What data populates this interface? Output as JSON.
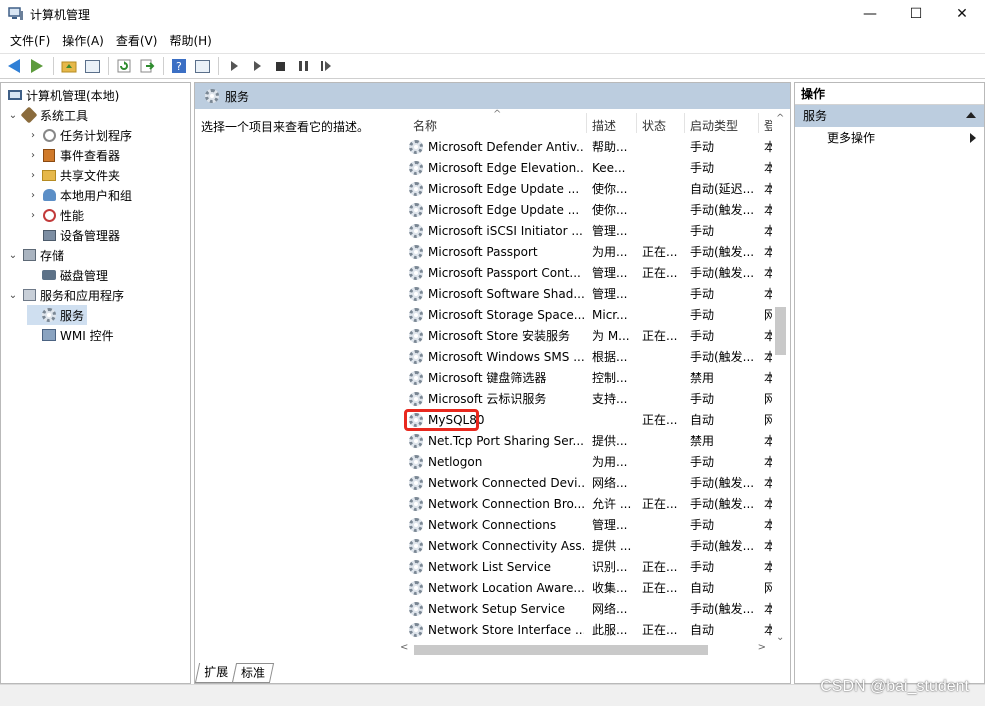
{
  "window": {
    "title": "计算机管理",
    "min": "—",
    "max": "☐",
    "close": "✕"
  },
  "menu": [
    "文件(F)",
    "操作(A)",
    "查看(V)",
    "帮助(H)"
  ],
  "tree": {
    "root": "计算机管理(本地)",
    "items": [
      {
        "label": "系统工具",
        "exp": "⌄"
      },
      {
        "label": "任务计划程序",
        "exp": "›"
      },
      {
        "label": "事件查看器",
        "exp": "›"
      },
      {
        "label": "共享文件夹",
        "exp": "›"
      },
      {
        "label": "本地用户和组",
        "exp": "›"
      },
      {
        "label": "性能",
        "exp": "›"
      },
      {
        "label": "设备管理器",
        "exp": ""
      },
      {
        "label": "存储",
        "exp": "⌄"
      },
      {
        "label": "磁盘管理",
        "exp": ""
      },
      {
        "label": "服务和应用程序",
        "exp": "⌄"
      },
      {
        "label": "服务",
        "exp": ""
      },
      {
        "label": "WMI 控件",
        "exp": ""
      }
    ]
  },
  "middle": {
    "header": "服务",
    "description": "选择一个项目来查看它的描述。",
    "columns": {
      "name": "名称",
      "desc": "描述",
      "status": "状态",
      "startup": "启动类型",
      "logon": "登"
    },
    "sort_indicator": "^",
    "rows": [
      {
        "name": "Microsoft Defender Antiv...",
        "desc": "帮助...",
        "status": "",
        "startup": "手动",
        "logon": "本"
      },
      {
        "name": "Microsoft Edge Elevation...",
        "desc": "Kee...",
        "status": "",
        "startup": "手动",
        "logon": "本"
      },
      {
        "name": "Microsoft Edge Update ...",
        "desc": "使你...",
        "status": "",
        "startup": "自动(延迟...",
        "logon": "本"
      },
      {
        "name": "Microsoft Edge Update ...",
        "desc": "使你...",
        "status": "",
        "startup": "手动(触发...",
        "logon": "本"
      },
      {
        "name": "Microsoft iSCSI Initiator ...",
        "desc": "管理...",
        "status": "",
        "startup": "手动",
        "logon": "本"
      },
      {
        "name": "Microsoft Passport",
        "desc": "为用...",
        "status": "正在...",
        "startup": "手动(触发...",
        "logon": "本"
      },
      {
        "name": "Microsoft Passport Cont...",
        "desc": "管理...",
        "status": "正在...",
        "startup": "手动(触发...",
        "logon": "本"
      },
      {
        "name": "Microsoft Software Shad...",
        "desc": "管理...",
        "status": "",
        "startup": "手动",
        "logon": "本"
      },
      {
        "name": "Microsoft Storage Space...",
        "desc": "Micr...",
        "status": "",
        "startup": "手动",
        "logon": "网"
      },
      {
        "name": "Microsoft Store 安装服务",
        "desc": "为 M...",
        "status": "正在...",
        "startup": "手动",
        "logon": "本"
      },
      {
        "name": "Microsoft Windows SMS ...",
        "desc": "根据...",
        "status": "",
        "startup": "手动(触发...",
        "logon": "本"
      },
      {
        "name": "Microsoft 键盘筛选器",
        "desc": "控制...",
        "status": "",
        "startup": "禁用",
        "logon": "本"
      },
      {
        "name": "Microsoft 云标识服务",
        "desc": "支持...",
        "status": "",
        "startup": "手动",
        "logon": "网"
      },
      {
        "name": "MySQL80",
        "desc": "",
        "status": "正在...",
        "startup": "自动",
        "logon": "网"
      },
      {
        "name": "Net.Tcp Port Sharing Ser...",
        "desc": "提供...",
        "status": "",
        "startup": "禁用",
        "logon": "本"
      },
      {
        "name": "Netlogon",
        "desc": "为用...",
        "status": "",
        "startup": "手动",
        "logon": "本"
      },
      {
        "name": "Network Connected Devi...",
        "desc": "网络...",
        "status": "",
        "startup": "手动(触发...",
        "logon": "本"
      },
      {
        "name": "Network Connection Bro...",
        "desc": "允许 ...",
        "status": "正在...",
        "startup": "手动(触发...",
        "logon": "本"
      },
      {
        "name": "Network Connections",
        "desc": "管理...",
        "status": "",
        "startup": "手动",
        "logon": "本"
      },
      {
        "name": "Network Connectivity Ass...",
        "desc": "提供 ...",
        "status": "",
        "startup": "手动(触发...",
        "logon": "本"
      },
      {
        "name": "Network List Service",
        "desc": "识别...",
        "status": "正在...",
        "startup": "手动",
        "logon": "本"
      },
      {
        "name": "Network Location Aware...",
        "desc": "收集...",
        "status": "正在...",
        "startup": "自动",
        "logon": "网"
      },
      {
        "name": "Network Setup Service",
        "desc": "网络...",
        "status": "",
        "startup": "手动(触发...",
        "logon": "本"
      },
      {
        "name": "Network Store Interface ...",
        "desc": "此服...",
        "status": "正在...",
        "startup": "自动",
        "logon": "本"
      }
    ],
    "tabs": [
      "扩展",
      "标准"
    ],
    "scroll": {
      "up": "^",
      "down": "⌄",
      "left": "<",
      "right": ">"
    }
  },
  "actions": {
    "header": "操作",
    "section": "服务",
    "more": "更多操作"
  },
  "watermark": "CSDN @bai_student",
  "colors": {
    "header_bg": "#bccddf",
    "highlight": "#e8281e"
  }
}
